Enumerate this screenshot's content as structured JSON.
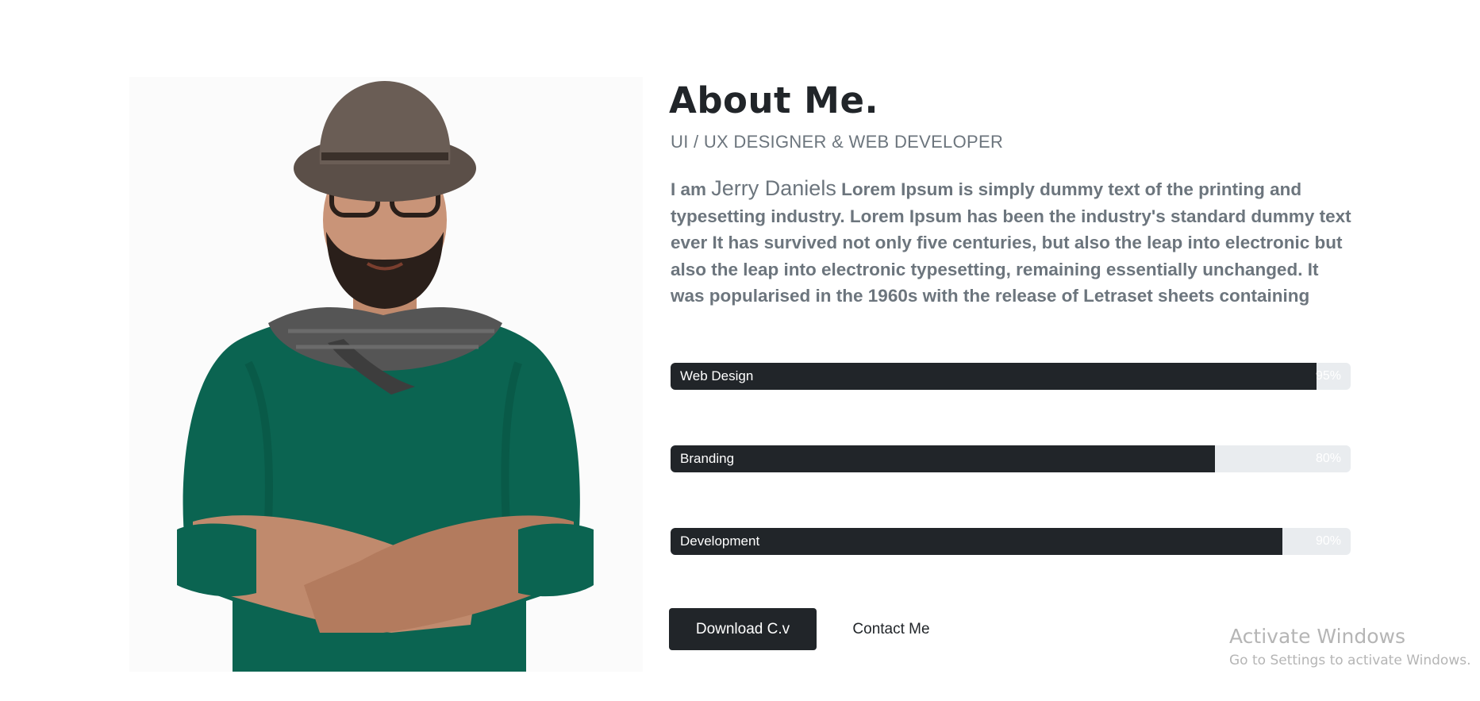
{
  "about": {
    "title": "About Me.",
    "subtitle": "UI / UX DESIGNER & WEB DEVELOPER",
    "bio_prefix": "I am ",
    "bio_name": "Jerry Daniels",
    "bio_text": " Lorem Ipsum is simply dummy text of the printing and typesetting industry. Lorem Ipsum has been the industry's standard dummy text ever It has survived not only five centuries, but also the leap into electronic but also the leap into electronic typesetting, remaining essentially unchanged. It was popularised in the 1960s with the release of Letraset sheets containing"
  },
  "skills": [
    {
      "label": "Web Design",
      "percent_label": "95%",
      "value": 95
    },
    {
      "label": "Branding",
      "percent_label": "80%",
      "value": 80
    },
    {
      "label": "Development",
      "percent_label": "90%",
      "value": 90
    }
  ],
  "buttons": {
    "download": "Download C.v",
    "contact": "Contact Me"
  },
  "watermark": {
    "title": "Activate Windows",
    "subtitle": "Go to Settings to activate Windows."
  },
  "colors": {
    "bar_fill": "#212529",
    "bar_track": "#e9ecef",
    "sweater": "#0b6451",
    "muted_text": "#6c757d"
  }
}
